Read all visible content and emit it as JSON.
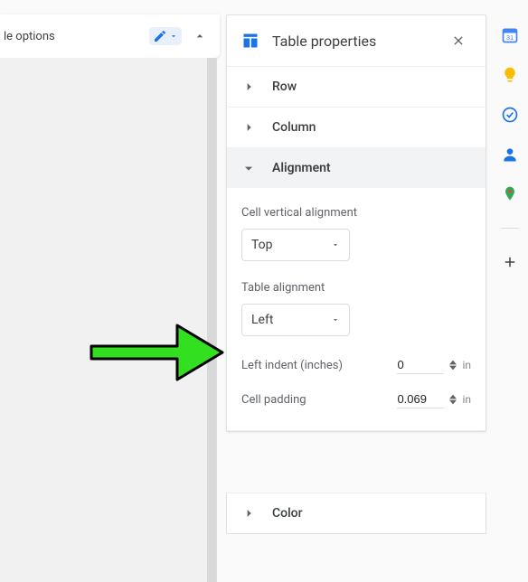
{
  "toolbar": {
    "truncated_text": "le options",
    "edit_icon": "pencil",
    "edit_dropdown_icon": "caret-down",
    "collapse_icon": "chevron-up"
  },
  "panel": {
    "title": "Table properties",
    "close_icon": "close",
    "table_icon": "table",
    "sections": {
      "row": {
        "label": "Row",
        "expanded": false
      },
      "column": {
        "label": "Column",
        "expanded": false
      },
      "alignment": {
        "label": "Alignment",
        "expanded": true
      },
      "color": {
        "label": "Color",
        "expanded": false
      }
    },
    "alignment_section": {
      "cell_vert_label": "Cell vertical alignment",
      "cell_vert_value": "Top",
      "table_align_label": "Table alignment",
      "table_align_value": "Left",
      "left_indent_label": "Left indent (inches)",
      "left_indent_value": "0",
      "left_indent_unit": "in",
      "cell_padding_label": "Cell padding",
      "cell_padding_value": "0.069",
      "cell_padding_unit": "in",
      "caret_icon": "caret-down"
    }
  },
  "right_rail": {
    "items": [
      "calendar",
      "keep",
      "tasks",
      "contacts",
      "maps"
    ],
    "plus_icon": "plus"
  },
  "annotation": {
    "arrow_color": "#33e01f"
  }
}
